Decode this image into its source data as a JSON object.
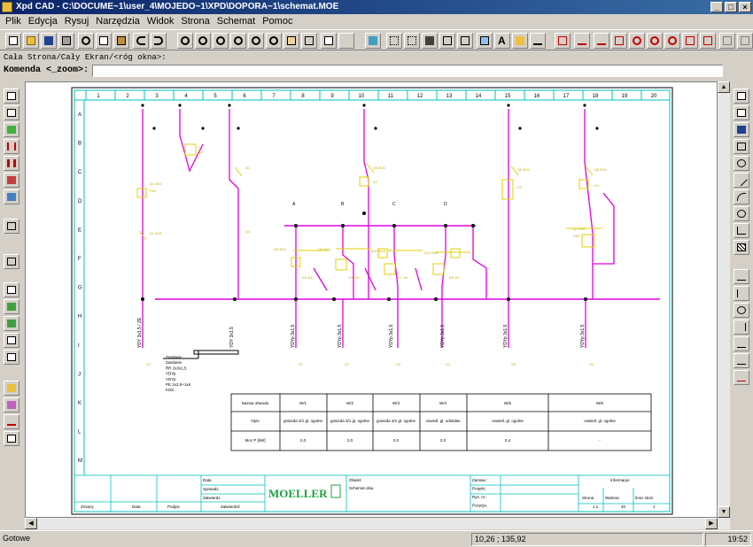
{
  "window": {
    "title": "Xpd CAD - C:\\DOCUME~1\\user_4\\MOJEDO~1\\XPD\\DOPORA~1\\schemat.MOE"
  },
  "menu": [
    "Plik",
    "Edycja",
    "Rysuj",
    "Narzędzia",
    "Widok",
    "Strona",
    "Schemat",
    "Pomoc"
  ],
  "command": {
    "history": "Cała Strona/Cały Ekran/<róg okna>:",
    "label": "Komenda <_zoom>:",
    "value": ""
  },
  "drawing": {
    "col_numbers": [
      "1",
      "2",
      "3",
      "4",
      "5",
      "6",
      "7",
      "8",
      "9",
      "10",
      "11",
      "12",
      "13",
      "14",
      "15",
      "16",
      "17",
      "18",
      "19",
      "20"
    ],
    "row_letters": [
      "A",
      "B",
      "C",
      "D",
      "E",
      "F",
      "G",
      "H",
      "I",
      "J",
      "K",
      "L",
      "M"
    ],
    "phase_labels": [
      "A",
      "B",
      "C",
      "D"
    ],
    "feed_labels": [
      "YDY 3x1,5 / ZE",
      "YDY 3x1,5",
      "YDYp 3x1,5",
      "YDYp 3x1,5",
      "YDYp 3x1,5",
      "YDYp 3x1,5",
      "YDYp 3x1,5",
      "YDYp 3x1,5"
    ],
    "note_lines": [
      "Zasilanie",
      "Zasilanie",
      "RR 2x3x1,5",
      "YDYp",
      "YDYp",
      "PE 2x2,5+1x6",
      "K/Zn"
    ],
    "table": {
      "headers": [
        "Nazwa obwodu",
        "W/1",
        "W/2",
        "W/3",
        "W/4",
        "W/5",
        "W/6"
      ],
      "row1_label": "Opis",
      "row1": [
        "gniazda 3/1 gl. ogolne",
        "gniazda 3/1 gl. ogolne",
        "gniazda 3/1 gl. ogolne",
        "oswietl. gl. odstalas",
        "oswietl. gl. ogolne",
        "oswietl. gl. ogolne"
      ],
      "row2_label": "Moc P [kW]",
      "row2": [
        "2,0",
        "2,0",
        "2,0",
        "2,0",
        "0,4",
        "-"
      ]
    },
    "titleblock": {
      "labels_left": [
        "Data",
        "Sprawdz.",
        "Zatwierdz.",
        "Zmiany",
        "Data",
        "Podpis",
        "Zatwierdzil"
      ],
      "logo": "MOELLER",
      "object_label": "Obiekt:",
      "object": "Schemat obw.",
      "right_labels": [
        "Zamaw.:",
        "Projekt.:",
        "Rys. nr.:",
        "Pozycja:"
      ],
      "page_labels": [
        "Strona",
        "Wartosc",
        "Ilosc stron"
      ],
      "page_values": [
        "1.1",
        "20",
        "1"
      ],
      "extra": "Informacje:"
    }
  },
  "status": {
    "mode": "Gotowe",
    "coords": "10,26 ; 135,92",
    "time": "19:52"
  }
}
